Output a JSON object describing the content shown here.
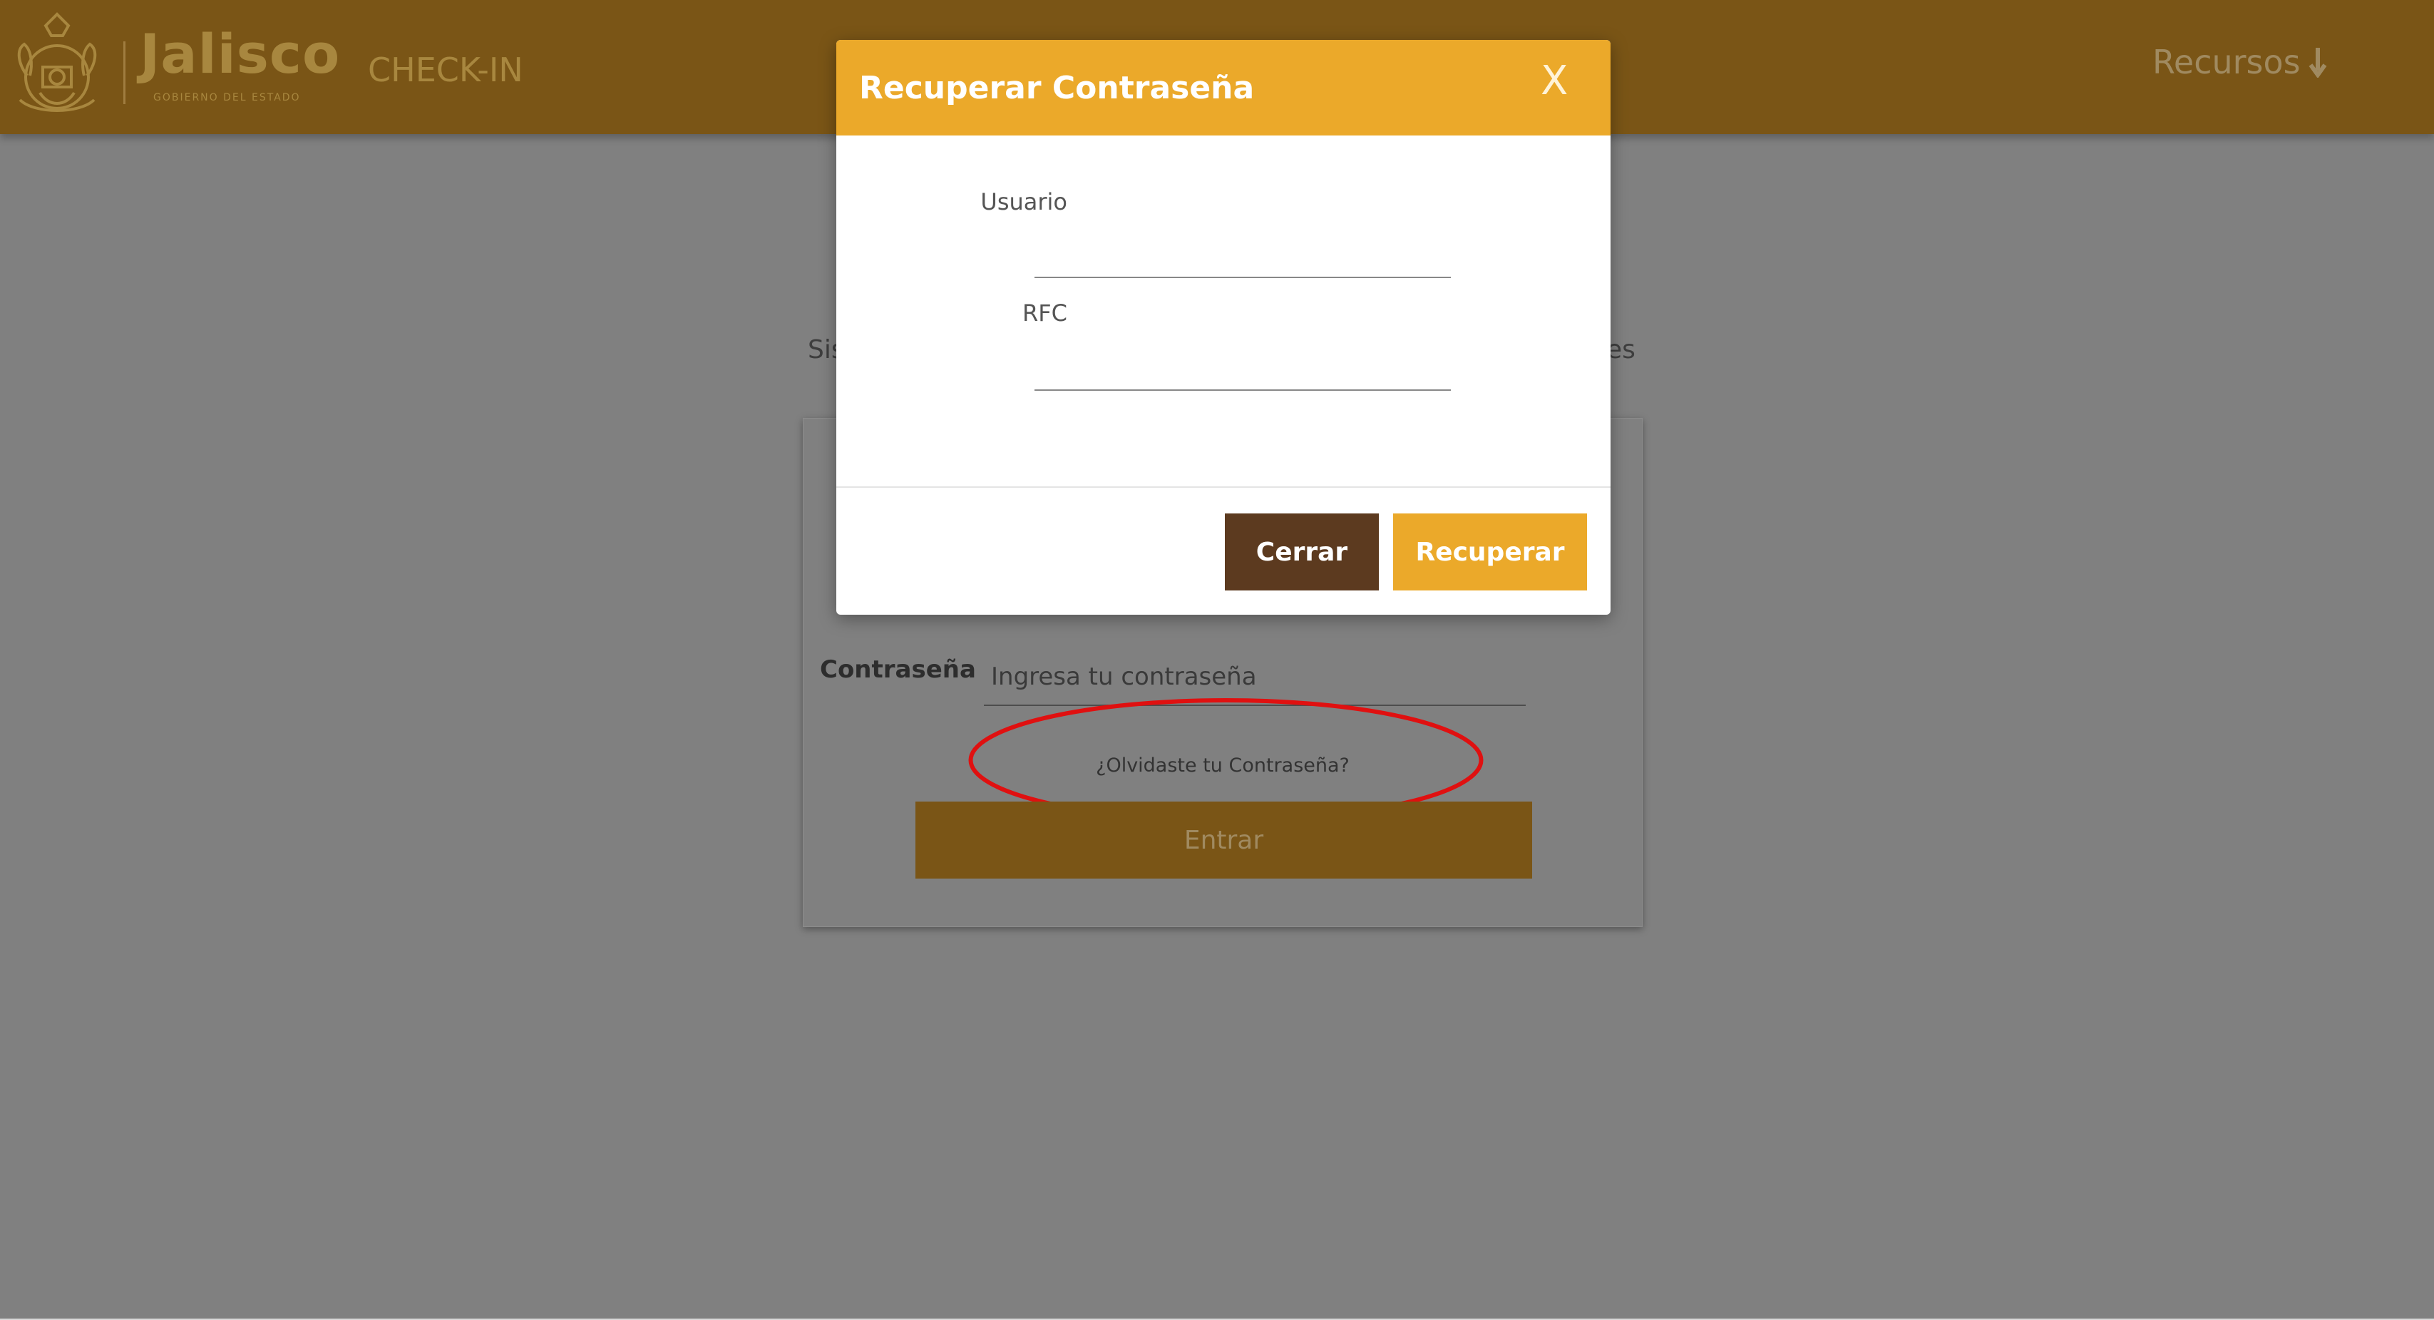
{
  "header": {
    "brand_name": "Jalisco",
    "brand_subtitle": "GOBIERNO DEL ESTADO",
    "app_name": "CHECK-IN",
    "resources_label": "Recursos",
    "background_color": "#7a5516"
  },
  "background_page": {
    "tagline_left_fragment": "Sis",
    "tagline_right_fragment": "es",
    "password_label": "Contraseña",
    "password_placeholder": "Ingresa tu contraseña",
    "forgot_password_link": "¿Olvidaste tu Contraseña?",
    "enter_button_label": "Entrar"
  },
  "modal": {
    "title": "Recuperar Contraseña",
    "close_label": "X",
    "usuario_label": "Usuario",
    "usuario_value": "",
    "rfc_label": "RFC",
    "rfc_value": "",
    "cancel_button_label": "Cerrar",
    "submit_button_label": "Recuperar",
    "accent_color": "#eba92a",
    "cancel_color": "#5c3a1f"
  },
  "annotation": {
    "shape": "ellipse",
    "color": "#e01010"
  }
}
